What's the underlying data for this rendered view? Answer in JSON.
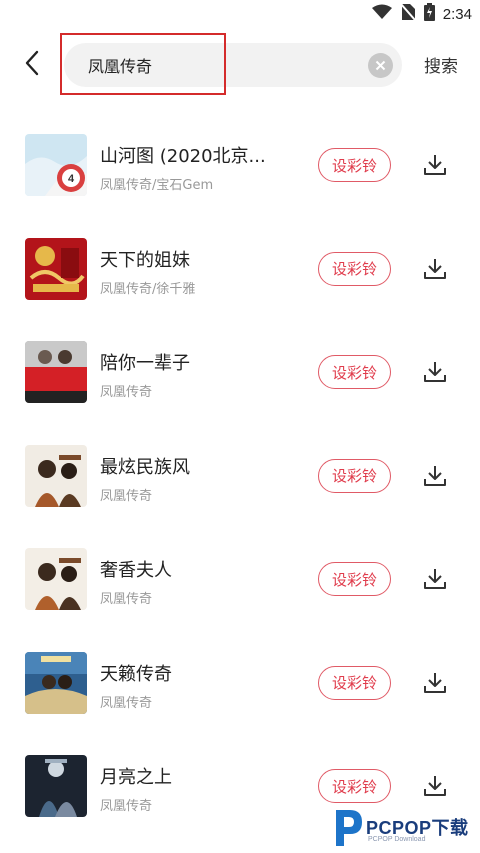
{
  "status_bar": {
    "time": "2:34",
    "icons": [
      "wifi-icon",
      "no-sim-icon",
      "battery-icon"
    ]
  },
  "search": {
    "back_icon": "chevron-left-icon",
    "query": "凤凰传奇",
    "clear_icon": "clear-icon",
    "search_label": "搜索"
  },
  "colors": {
    "accent": "#e03c4c",
    "highlight": "#d42b2b",
    "search_bg": "#f2f2f2"
  },
  "songs": [
    {
      "title": "山河图 (2020北京...",
      "subtitle": "凤凰传奇/宝石Gem",
      "ring_label": "设彩铃",
      "download_icon": "download-icon"
    },
    {
      "title": "天下的姐妹",
      "subtitle": "凤凰传奇/徐千雅",
      "ring_label": "设彩铃",
      "download_icon": "download-icon"
    },
    {
      "title": "陪你一辈子",
      "subtitle": "凤凰传奇",
      "ring_label": "设彩铃",
      "download_icon": "download-icon"
    },
    {
      "title": "最炫民族风",
      "subtitle": "凤凰传奇",
      "ring_label": "设彩铃",
      "download_icon": "download-icon"
    },
    {
      "title": "奢香夫人",
      "subtitle": "凤凰传奇",
      "ring_label": "设彩铃",
      "download_icon": "download-icon"
    },
    {
      "title": "天籁传奇",
      "subtitle": "凤凰传奇",
      "ring_label": "设彩铃",
      "download_icon": "download-icon"
    },
    {
      "title": "月亮之上",
      "subtitle": "凤凰传奇",
      "ring_label": "设彩铃",
      "download_icon": "download-icon"
    }
  ],
  "watermark": {
    "brand": "PCPOP下载",
    "tagline": "PCPOP Download"
  }
}
